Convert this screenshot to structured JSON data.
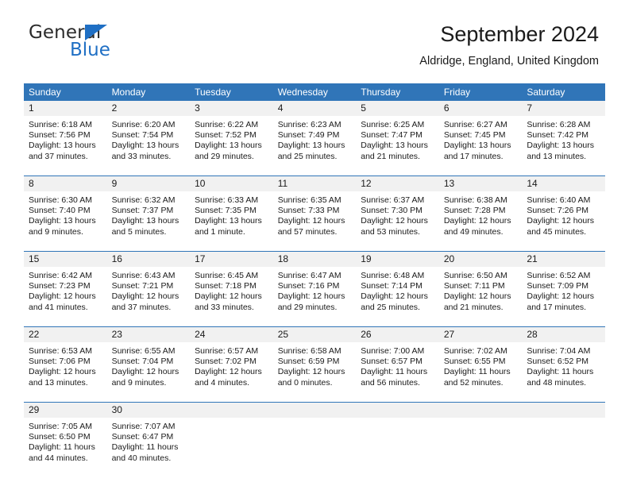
{
  "brand": {
    "word_one": "General",
    "word_two": "Blue",
    "accent_color": "#1f6fc4"
  },
  "header": {
    "title": "September 2024",
    "subtitle": "Aldridge, England, United Kingdom"
  },
  "theme": {
    "header_blue": "#3075b8",
    "daynum_band": "#f1f1f1",
    "text": "#1a1a1a"
  },
  "calendar": {
    "weekday_headers": [
      "Sunday",
      "Monday",
      "Tuesday",
      "Wednesday",
      "Thursday",
      "Friday",
      "Saturday"
    ],
    "weeks": [
      [
        {
          "day": "1",
          "sunrise": "Sunrise: 6:18 AM",
          "sunset": "Sunset: 7:56 PM",
          "daylight": "Daylight: 13 hours and 37 minutes."
        },
        {
          "day": "2",
          "sunrise": "Sunrise: 6:20 AM",
          "sunset": "Sunset: 7:54 PM",
          "daylight": "Daylight: 13 hours and 33 minutes."
        },
        {
          "day": "3",
          "sunrise": "Sunrise: 6:22 AM",
          "sunset": "Sunset: 7:52 PM",
          "daylight": "Daylight: 13 hours and 29 minutes."
        },
        {
          "day": "4",
          "sunrise": "Sunrise: 6:23 AM",
          "sunset": "Sunset: 7:49 PM",
          "daylight": "Daylight: 13 hours and 25 minutes."
        },
        {
          "day": "5",
          "sunrise": "Sunrise: 6:25 AM",
          "sunset": "Sunset: 7:47 PM",
          "daylight": "Daylight: 13 hours and 21 minutes."
        },
        {
          "day": "6",
          "sunrise": "Sunrise: 6:27 AM",
          "sunset": "Sunset: 7:45 PM",
          "daylight": "Daylight: 13 hours and 17 minutes."
        },
        {
          "day": "7",
          "sunrise": "Sunrise: 6:28 AM",
          "sunset": "Sunset: 7:42 PM",
          "daylight": "Daylight: 13 hours and 13 minutes."
        }
      ],
      [
        {
          "day": "8",
          "sunrise": "Sunrise: 6:30 AM",
          "sunset": "Sunset: 7:40 PM",
          "daylight": "Daylight: 13 hours and 9 minutes."
        },
        {
          "day": "9",
          "sunrise": "Sunrise: 6:32 AM",
          "sunset": "Sunset: 7:37 PM",
          "daylight": "Daylight: 13 hours and 5 minutes."
        },
        {
          "day": "10",
          "sunrise": "Sunrise: 6:33 AM",
          "sunset": "Sunset: 7:35 PM",
          "daylight": "Daylight: 13 hours and 1 minute."
        },
        {
          "day": "11",
          "sunrise": "Sunrise: 6:35 AM",
          "sunset": "Sunset: 7:33 PM",
          "daylight": "Daylight: 12 hours and 57 minutes."
        },
        {
          "day": "12",
          "sunrise": "Sunrise: 6:37 AM",
          "sunset": "Sunset: 7:30 PM",
          "daylight": "Daylight: 12 hours and 53 minutes."
        },
        {
          "day": "13",
          "sunrise": "Sunrise: 6:38 AM",
          "sunset": "Sunset: 7:28 PM",
          "daylight": "Daylight: 12 hours and 49 minutes."
        },
        {
          "day": "14",
          "sunrise": "Sunrise: 6:40 AM",
          "sunset": "Sunset: 7:26 PM",
          "daylight": "Daylight: 12 hours and 45 minutes."
        }
      ],
      [
        {
          "day": "15",
          "sunrise": "Sunrise: 6:42 AM",
          "sunset": "Sunset: 7:23 PM",
          "daylight": "Daylight: 12 hours and 41 minutes."
        },
        {
          "day": "16",
          "sunrise": "Sunrise: 6:43 AM",
          "sunset": "Sunset: 7:21 PM",
          "daylight": "Daylight: 12 hours and 37 minutes."
        },
        {
          "day": "17",
          "sunrise": "Sunrise: 6:45 AM",
          "sunset": "Sunset: 7:18 PM",
          "daylight": "Daylight: 12 hours and 33 minutes."
        },
        {
          "day": "18",
          "sunrise": "Sunrise: 6:47 AM",
          "sunset": "Sunset: 7:16 PM",
          "daylight": "Daylight: 12 hours and 29 minutes."
        },
        {
          "day": "19",
          "sunrise": "Sunrise: 6:48 AM",
          "sunset": "Sunset: 7:14 PM",
          "daylight": "Daylight: 12 hours and 25 minutes."
        },
        {
          "day": "20",
          "sunrise": "Sunrise: 6:50 AM",
          "sunset": "Sunset: 7:11 PM",
          "daylight": "Daylight: 12 hours and 21 minutes."
        },
        {
          "day": "21",
          "sunrise": "Sunrise: 6:52 AM",
          "sunset": "Sunset: 7:09 PM",
          "daylight": "Daylight: 12 hours and 17 minutes."
        }
      ],
      [
        {
          "day": "22",
          "sunrise": "Sunrise: 6:53 AM",
          "sunset": "Sunset: 7:06 PM",
          "daylight": "Daylight: 12 hours and 13 minutes."
        },
        {
          "day": "23",
          "sunrise": "Sunrise: 6:55 AM",
          "sunset": "Sunset: 7:04 PM",
          "daylight": "Daylight: 12 hours and 9 minutes."
        },
        {
          "day": "24",
          "sunrise": "Sunrise: 6:57 AM",
          "sunset": "Sunset: 7:02 PM",
          "daylight": "Daylight: 12 hours and 4 minutes."
        },
        {
          "day": "25",
          "sunrise": "Sunrise: 6:58 AM",
          "sunset": "Sunset: 6:59 PM",
          "daylight": "Daylight: 12 hours and 0 minutes."
        },
        {
          "day": "26",
          "sunrise": "Sunrise: 7:00 AM",
          "sunset": "Sunset: 6:57 PM",
          "daylight": "Daylight: 11 hours and 56 minutes."
        },
        {
          "day": "27",
          "sunrise": "Sunrise: 7:02 AM",
          "sunset": "Sunset: 6:55 PM",
          "daylight": "Daylight: 11 hours and 52 minutes."
        },
        {
          "day": "28",
          "sunrise": "Sunrise: 7:04 AM",
          "sunset": "Sunset: 6:52 PM",
          "daylight": "Daylight: 11 hours and 48 minutes."
        }
      ],
      [
        {
          "day": "29",
          "sunrise": "Sunrise: 7:05 AM",
          "sunset": "Sunset: 6:50 PM",
          "daylight": "Daylight: 11 hours and 44 minutes."
        },
        {
          "day": "30",
          "sunrise": "Sunrise: 7:07 AM",
          "sunset": "Sunset: 6:47 PM",
          "daylight": "Daylight: 11 hours and 40 minutes."
        },
        {
          "day": "",
          "sunrise": "",
          "sunset": "",
          "daylight": ""
        },
        {
          "day": "",
          "sunrise": "",
          "sunset": "",
          "daylight": ""
        },
        {
          "day": "",
          "sunrise": "",
          "sunset": "",
          "daylight": ""
        },
        {
          "day": "",
          "sunrise": "",
          "sunset": "",
          "daylight": ""
        },
        {
          "day": "",
          "sunrise": "",
          "sunset": "",
          "daylight": ""
        }
      ]
    ]
  }
}
